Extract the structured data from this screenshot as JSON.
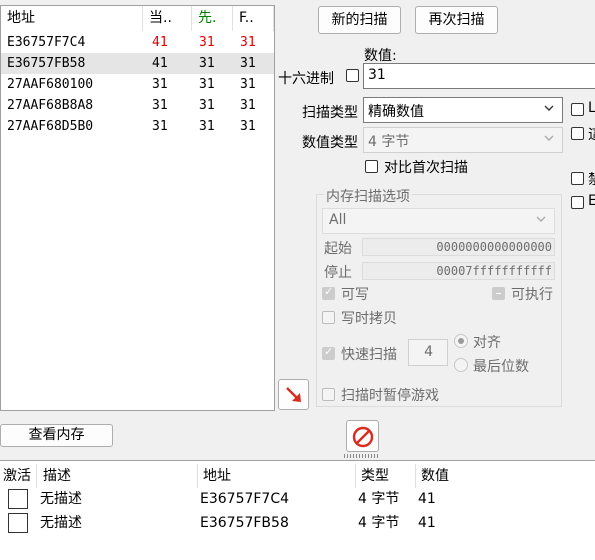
{
  "results": {
    "columns": [
      "地址",
      "当..",
      "先.",
      "F.."
    ],
    "rows": [
      {
        "address": "E36757F7C4",
        "current": "41",
        "previous": "31",
        "first": "31",
        "changed": true
      },
      {
        "address": "E36757FB58",
        "current": "41",
        "previous": "31",
        "first": "31",
        "changed": false
      },
      {
        "address": "27AAF680100",
        "current": "31",
        "previous": "31",
        "first": "31",
        "changed": false
      },
      {
        "address": "27AAF68B8A8",
        "current": "31",
        "previous": "31",
        "first": "31",
        "changed": false
      },
      {
        "address": "27AAF68D5B0",
        "current": "31",
        "previous": "31",
        "first": "31",
        "changed": false
      }
    ]
  },
  "buttons": {
    "new_scan": "新的扫描",
    "next_scan": "再次扫描",
    "view_memory": "查看内存"
  },
  "value": {
    "label": "数值:",
    "hex_label": "十六进制",
    "input": "31"
  },
  "scan_type": {
    "label": "扫描类型",
    "value": "精确数值"
  },
  "value_type": {
    "label": "数值类型",
    "value": "4 字节"
  },
  "compare_first": "对比首次扫描",
  "memory_options": {
    "title": "内存扫描选项",
    "region": "All",
    "start_label": "起始",
    "start_value": "0000000000000000",
    "stop_label": "停止",
    "stop_value": "00007fffffffffff",
    "writable": "可写",
    "executable": "可执行",
    "copy_on_write": "写时拷贝",
    "fast_scan": "快速扫描",
    "fast_scan_value": "4",
    "align": "对齐",
    "last_digits": "最后位数",
    "pause_game": "扫描时暂停游戏"
  },
  "right_edge": {
    "l1": "L",
    "l2": "這",
    "l3": "禁",
    "l4": "E"
  },
  "address_list": {
    "columns": [
      "激活",
      "描述",
      "地址",
      "类型",
      "数值"
    ],
    "rows": [
      {
        "description": "无描述",
        "address": "E36757F7C4",
        "type": "4 字节",
        "value": "41"
      },
      {
        "description": "无描述",
        "address": "E36757FB58",
        "type": "4 字节",
        "value": "41"
      }
    ]
  },
  "colors": {
    "changed": "#e00000",
    "previous_header": "#008000"
  },
  "icons": [
    "add-to-list-arrow-icon",
    "stop-scan-icon",
    "splitter-dots-icon",
    "chevron-down-icon"
  ]
}
